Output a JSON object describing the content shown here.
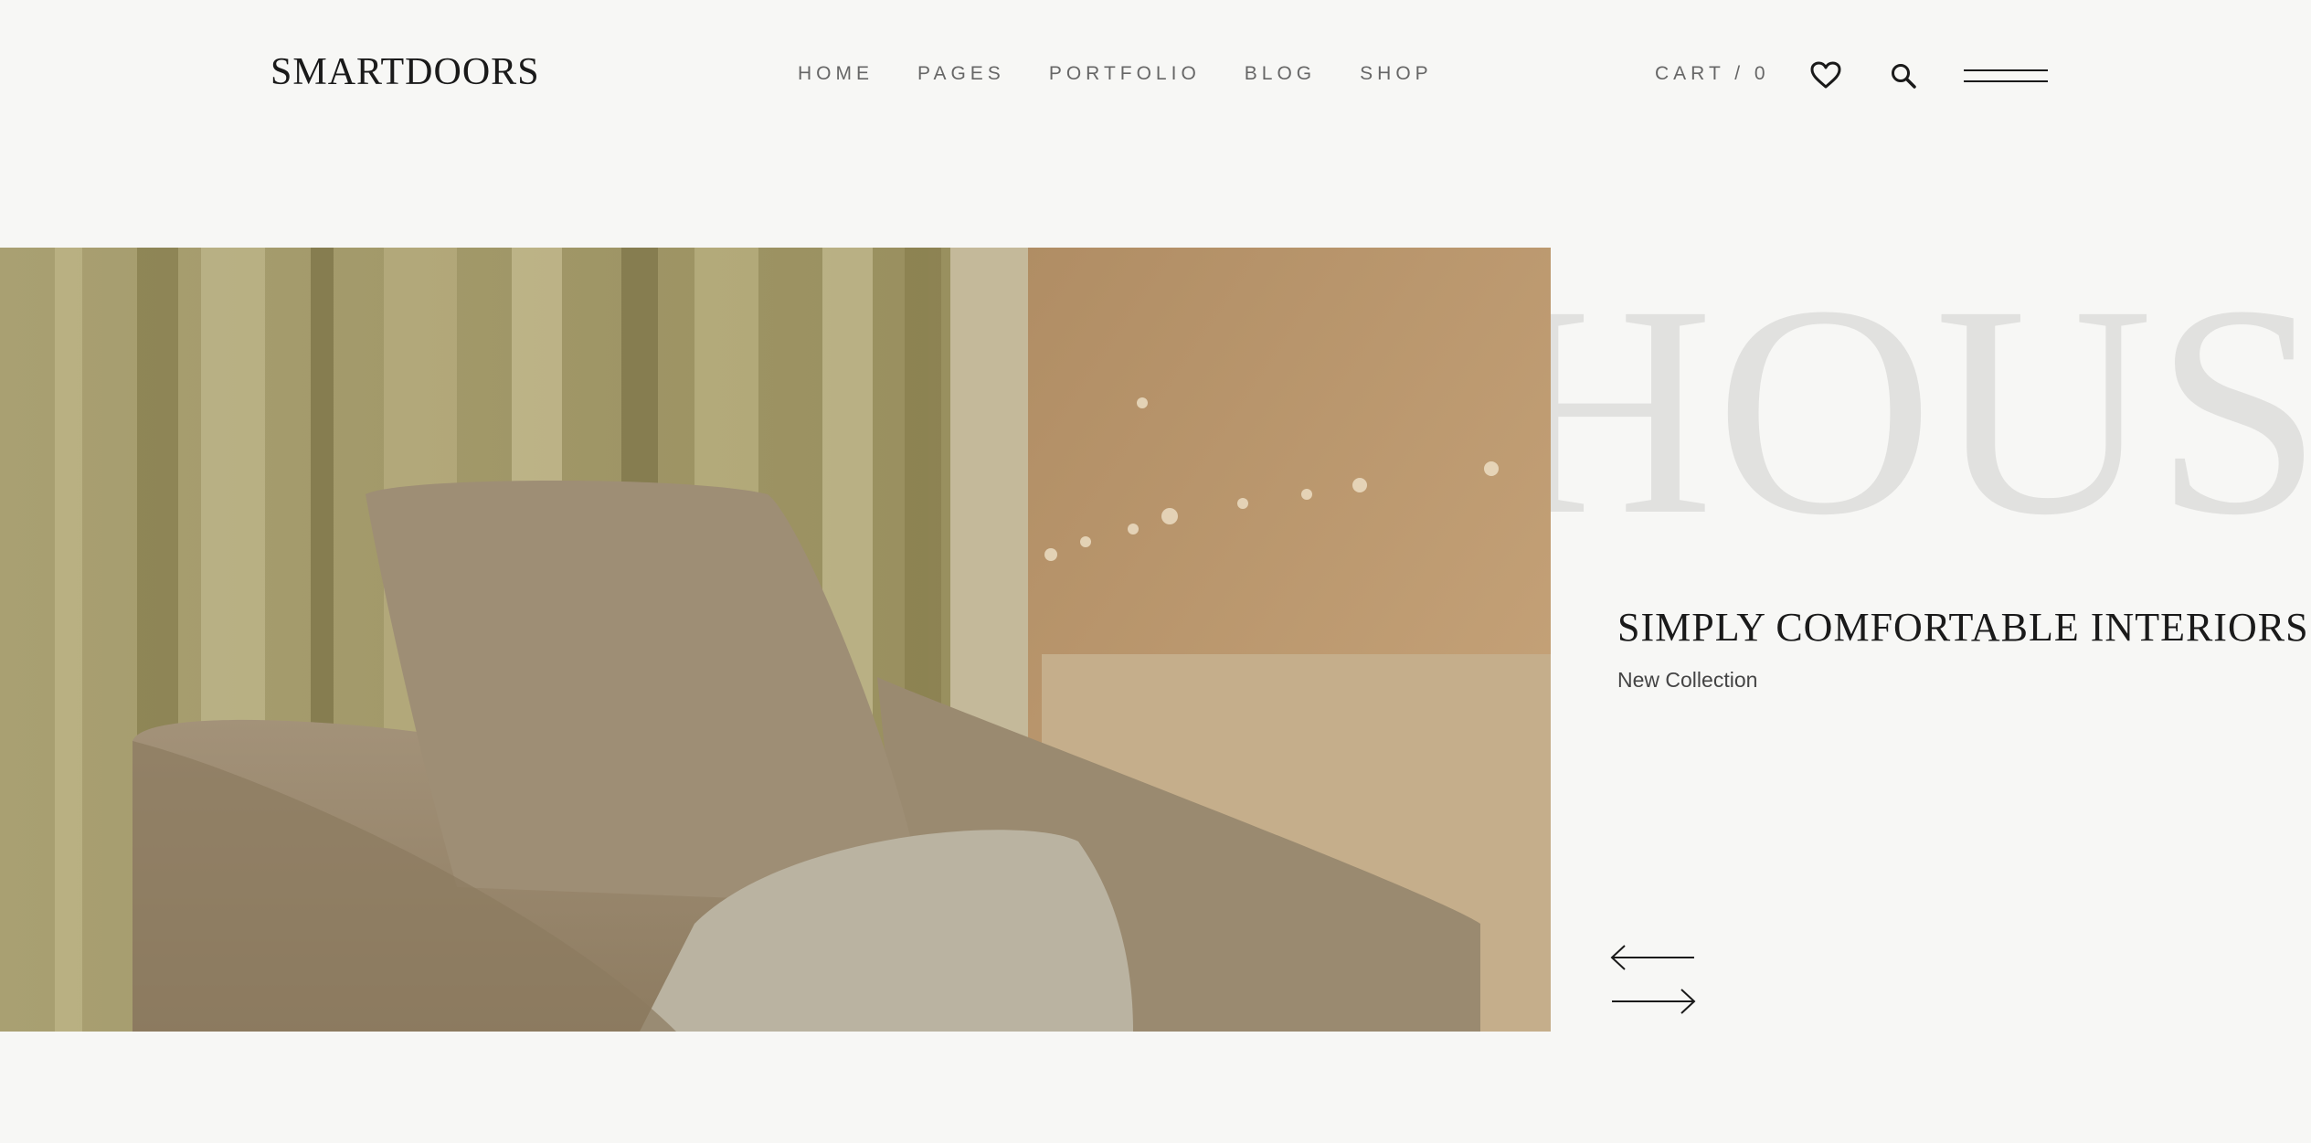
{
  "header": {
    "logo": "SMARTDOORS",
    "nav": [
      "HOME",
      "PAGES",
      "PORTFOLIO",
      "BLOG",
      "SHOP"
    ],
    "cart_label": "CART / 0",
    "icons": [
      "heart-icon",
      "search-icon",
      "menu-icon"
    ]
  },
  "hero": {
    "big_word": "HOUST",
    "headline": "SIMPLY COMFORTABLE INTERIORS",
    "subline": "New Collection",
    "controls": [
      "arrow-left-icon",
      "arrow-right-icon"
    ]
  },
  "colors": {
    "background": "#f7f7f5",
    "text": "#1a1a1a",
    "muted_text": "#666666",
    "watermark": "#e1e1df"
  }
}
